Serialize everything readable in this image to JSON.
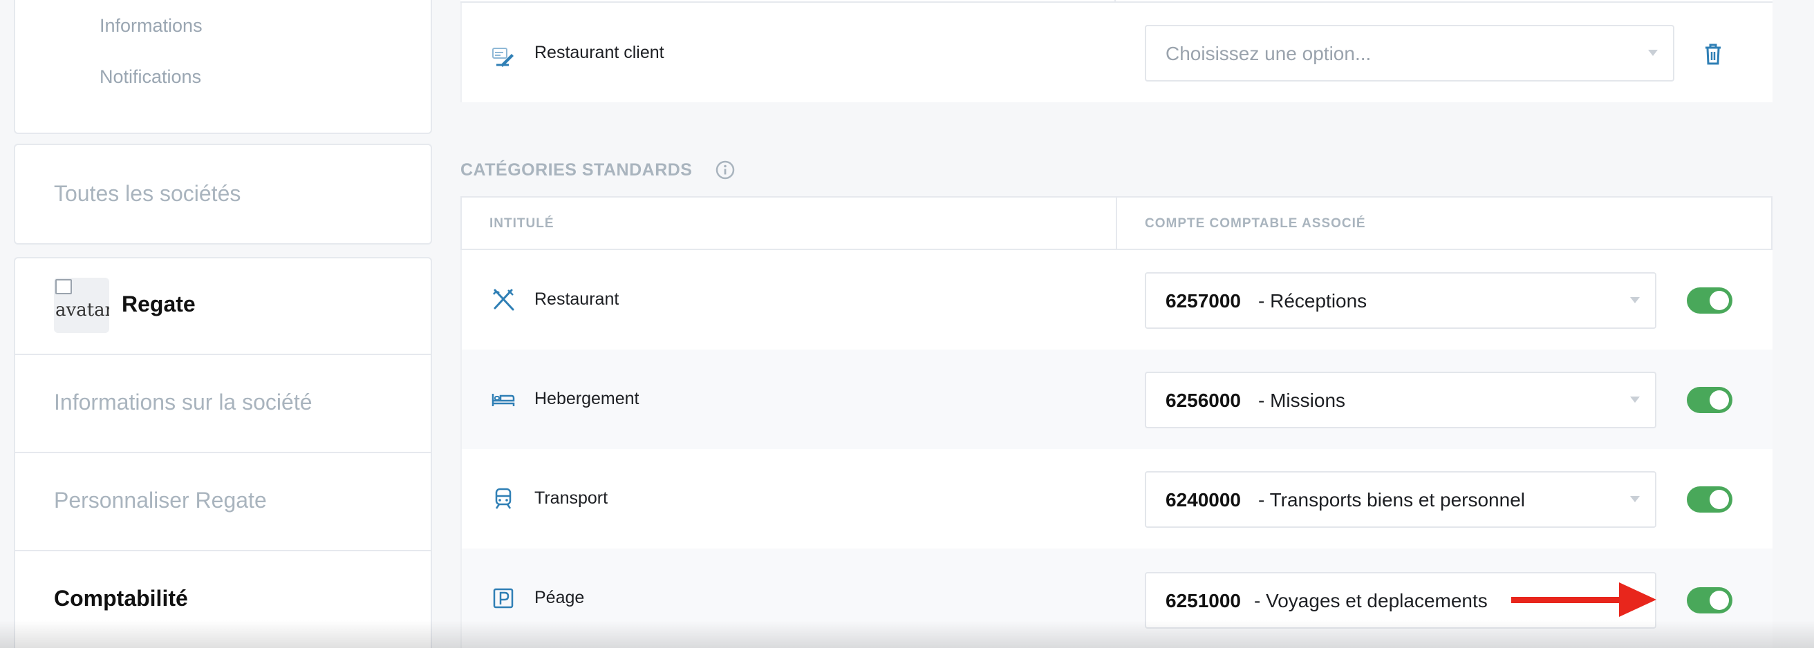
{
  "sidebar": {
    "profile_sub_items": [
      "Informations",
      "Notifications"
    ],
    "all_companies_label": "Toutes les sociétés",
    "company": {
      "avatar_alt": "avatar",
      "name": "Regate",
      "menu": [
        {
          "label": "Informations sur la société",
          "active": false
        },
        {
          "label": "Personnaliser Regate",
          "active": false
        },
        {
          "label": "Comptabilité",
          "active": true
        }
      ]
    }
  },
  "custom_row": {
    "name": "Restaurant client",
    "icon": "restaurant-client-icon",
    "select_placeholder": "Choisissez une option...",
    "delete_icon": "trash-icon"
  },
  "standard_categories": {
    "title": "CATÉGORIES STANDARDS",
    "info_icon": "info-icon",
    "columns": [
      "INTITULÉ",
      "COMPTE COMPTABLE ASSOCIÉ"
    ],
    "rows": [
      {
        "name": "Restaurant",
        "icon": "cutlery-icon",
        "code": "6257000",
        "desc": "- Réceptions",
        "enabled": true
      },
      {
        "name": "Hebergement",
        "icon": "bed-icon",
        "code": "6256000",
        "desc": "- Missions",
        "enabled": true
      },
      {
        "name": "Transport",
        "icon": "train-icon",
        "code": "6240000",
        "desc": "- Transports biens et personnel",
        "enabled": true
      },
      {
        "name": "Péage",
        "icon": "parking-icon",
        "code": "6251000",
        "desc": "- Voyages et deplacements",
        "enabled": true
      }
    ]
  },
  "colors": {
    "toggle_on": "#49a85a",
    "icon_blue": "#2f7fb5",
    "annotation_arrow": "#e8261c"
  }
}
